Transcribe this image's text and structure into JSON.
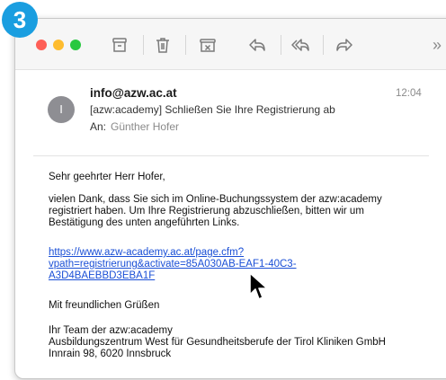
{
  "step_badge": "3",
  "toolbar": {
    "icons": [
      "archive-icon",
      "trash-icon",
      "junk-icon",
      "reply-icon",
      "reply-all-icon",
      "forward-icon",
      "more-icon"
    ],
    "more_label": "»"
  },
  "email": {
    "avatar_initial": "I",
    "from": "info@azw.ac.at",
    "time": "12:04",
    "subject": "[azw:academy] Schließen Sie Ihre Registrierung ab",
    "to_label": "An:",
    "to_name": "Günther Hofer",
    "greeting": "Sehr geehrter Herr Hofer,",
    "para1_line1": "vielen Dank, dass Sie sich im Online-Buchungssystem der azw:academy",
    "para1_line2": "registriert haben. Um Ihre Registrierung abzuschließen, bitten wir um",
    "para1_line3": "Bestätigung des unten angeführten Links.",
    "link_line1": "https://www.azw-academy.ac.at/page.cfm?",
    "link_line2": "vpath=registrierung&activate=85A030AB-EAF1-40C3-",
    "link_line3": "A3D4BAEBBD3EBA1F",
    "closing": "Mit freundlichen Grüßen",
    "sig_line1": "Ihr Team der azw:academy",
    "sig_line2": "Ausbildungszentrum West für Gesundheitsberufe der Tirol Kliniken GmbH",
    "sig_line3": "Innrain 98, 6020 Innsbruck"
  },
  "colors": {
    "badge": "#1a9ee0",
    "link": "#1a4fd6",
    "close": "#fe5f57",
    "minimize": "#febc2e",
    "zoom": "#28c840"
  }
}
